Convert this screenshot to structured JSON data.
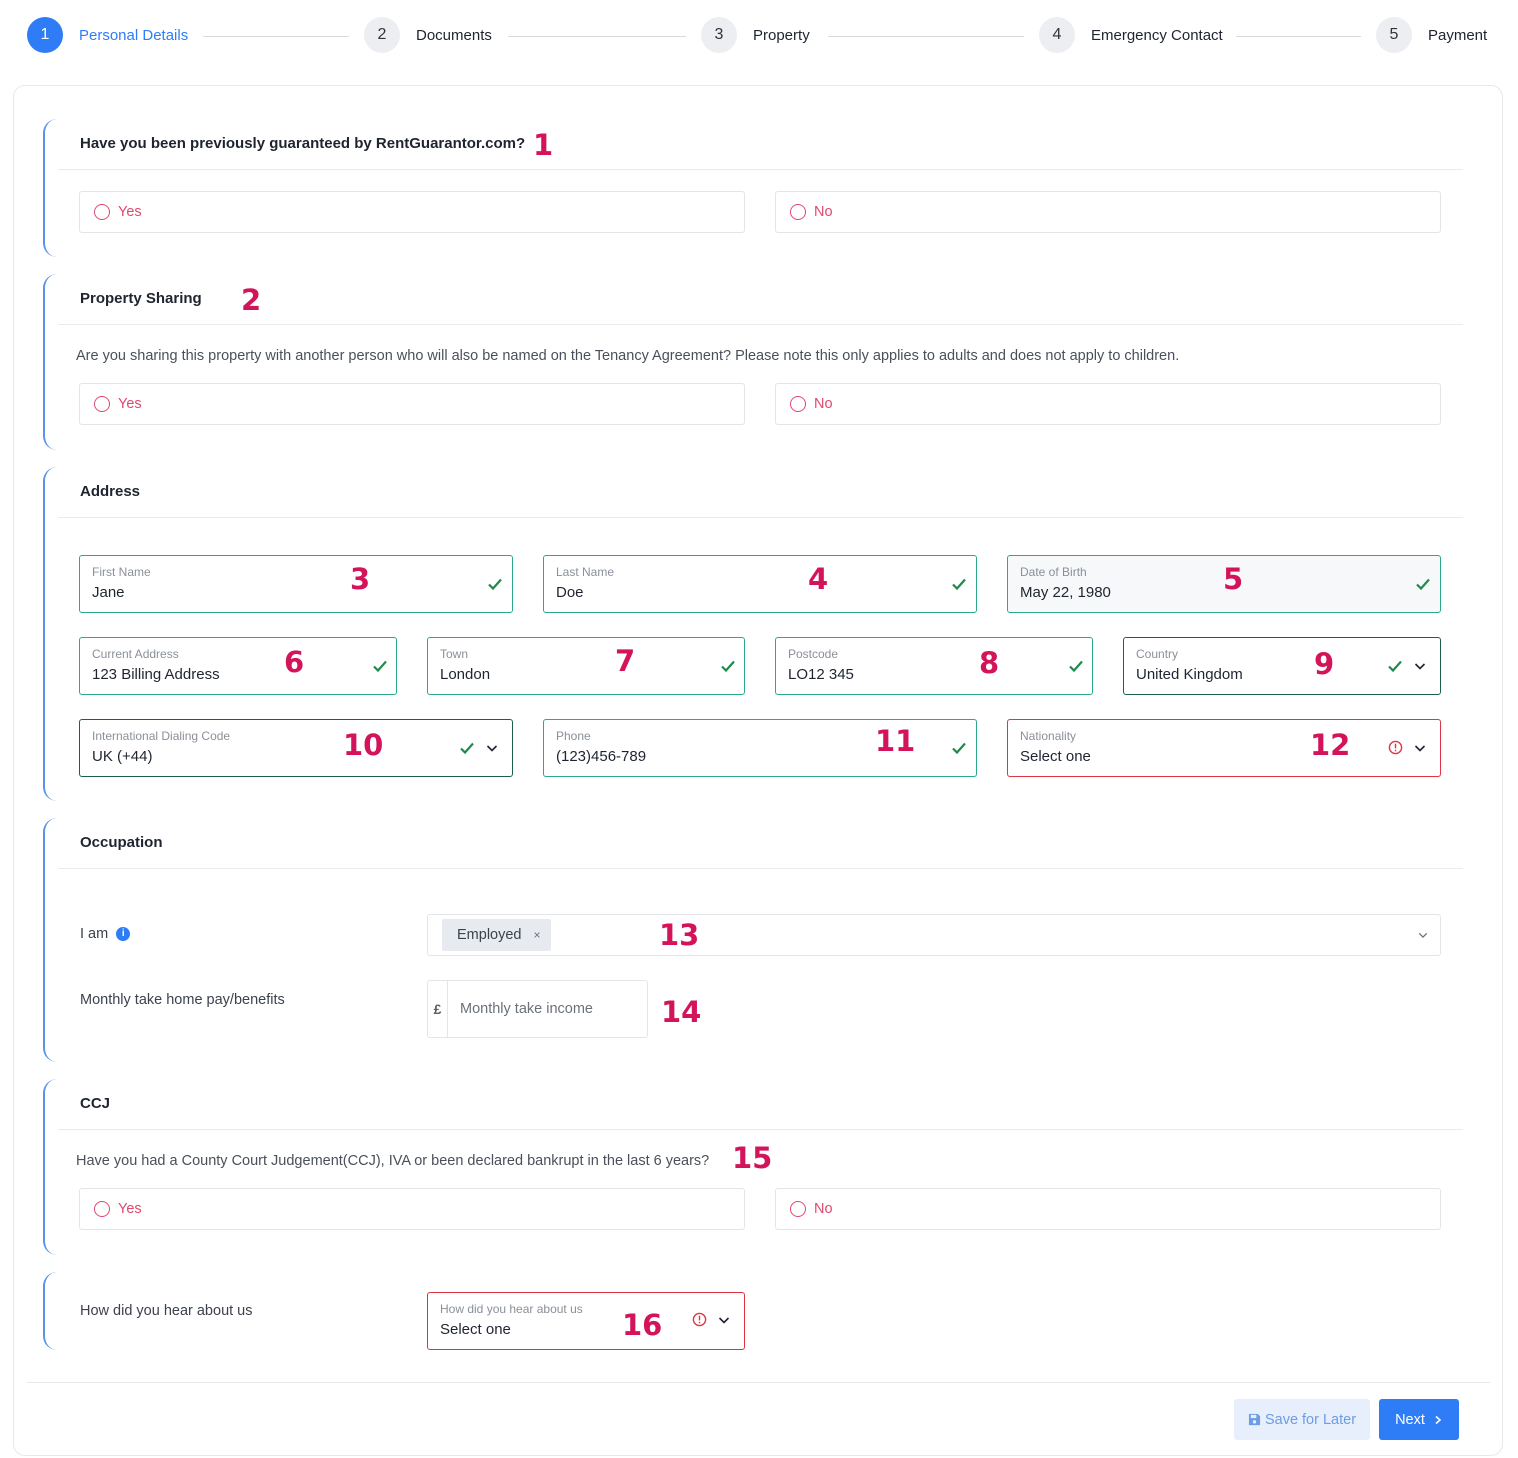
{
  "stepper": {
    "steps": [
      {
        "num": "1",
        "label": "Personal Details"
      },
      {
        "num": "2",
        "label": "Documents"
      },
      {
        "num": "3",
        "label": "Property"
      },
      {
        "num": "4",
        "label": "Emergency Contact"
      },
      {
        "num": "5",
        "label": "Payment"
      }
    ],
    "active_step": 1
  },
  "guaranteed": {
    "question": "Have you been previously guaranteed by RentGuarantor.com?",
    "yes": "Yes",
    "no": "No",
    "annotation": "1"
  },
  "sharing": {
    "title": "Property Sharing",
    "question": "Are you sharing this property with another person who will also be named on the Tenancy Agreement? Please note this only applies to adults and does not apply to children.",
    "yes": "Yes",
    "no": "No",
    "annotation": "2"
  },
  "address": {
    "title": "Address",
    "first_name": {
      "label": "First Name",
      "value": "Jane",
      "annotation": "3"
    },
    "last_name": {
      "label": "Last Name",
      "value": "Doe",
      "annotation": "4"
    },
    "dob": {
      "label": "Date of Birth",
      "value": "May 22, 1980",
      "annotation": "5"
    },
    "current_address": {
      "label": "Current Address",
      "value": "123 Billing Address",
      "annotation": "6"
    },
    "town": {
      "label": "Town",
      "value": "London",
      "annotation": "7"
    },
    "postcode": {
      "label": "Postcode",
      "value": "LO12 345",
      "annotation": "8"
    },
    "country": {
      "label": "Country",
      "value": "United Kingdom",
      "annotation": "9"
    },
    "dialing_code": {
      "label": "International Dialing Code",
      "value": "UK (+44)",
      "annotation": "10"
    },
    "phone": {
      "label": "Phone",
      "value": "(123)456-789",
      "annotation": "11"
    },
    "nationality": {
      "label": "Nationality",
      "value": "Select one",
      "annotation": "12"
    }
  },
  "occupation": {
    "title": "Occupation",
    "i_am_label": "I am",
    "i_am_tag": "Employed",
    "i_am_annotation": "13",
    "pay_label": "Monthly take home pay/benefits",
    "currency_symbol": "£",
    "pay_placeholder": "Monthly take income",
    "pay_annotation": "14"
  },
  "ccj": {
    "title": "CCJ",
    "question": "Have you had a County Court Judgement(CCJ), IVA or been declared bankrupt in the last 6 years?",
    "yes": "Yes",
    "no": "No",
    "annotation": "15"
  },
  "hear": {
    "label": "How did you hear about us",
    "field_label": "How did you hear about us",
    "value": "Select one",
    "annotation": "16"
  },
  "footer": {
    "save_label": "Save for Later",
    "next_label": "Next"
  },
  "colors": {
    "primary": "#2f7df6",
    "valid": "#2aaa8a",
    "error": "#dc3545",
    "radio": "#e0486e",
    "annotation": "#d4145a"
  }
}
